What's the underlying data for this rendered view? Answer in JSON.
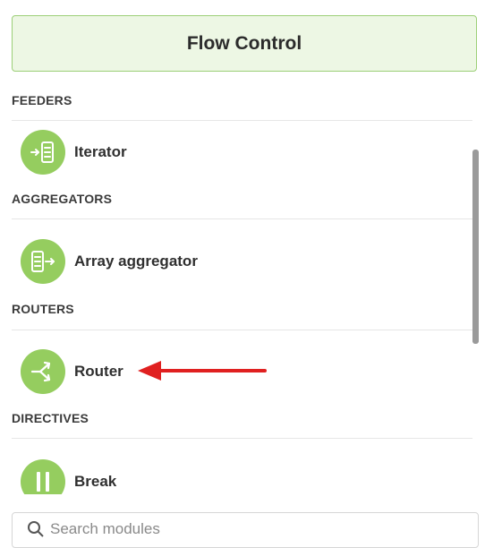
{
  "header": {
    "title": "Flow Control"
  },
  "sections": {
    "feeders": {
      "title": "FEEDERS",
      "items": [
        {
          "label": "Iterator",
          "icon": "iterator-icon"
        }
      ]
    },
    "aggregators": {
      "title": "AGGREGATORS",
      "items": [
        {
          "label": "Array aggregator",
          "icon": "array-aggregator-icon"
        }
      ]
    },
    "routers": {
      "title": "ROUTERS",
      "items": [
        {
          "label": "Router",
          "icon": "router-icon"
        }
      ]
    },
    "directives": {
      "title": "DIRECTIVES",
      "items": [
        {
          "label": "Break",
          "icon": "break-icon"
        }
      ]
    }
  },
  "search": {
    "placeholder": "Search modules"
  },
  "colors": {
    "accent": "#95cd5f",
    "header_bg": "#edf7e4",
    "header_border": "#9ccf77",
    "annotation_arrow": "#e02020"
  }
}
